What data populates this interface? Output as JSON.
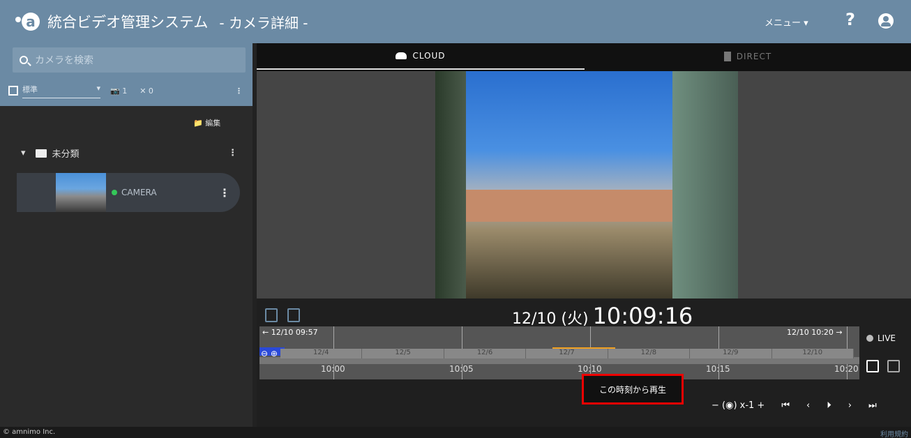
{
  "header": {
    "title": "統合ビデオ管理システム",
    "subtitle": "- カメラ詳細 -",
    "menu_label": "メニュー ▾",
    "help_label": "?"
  },
  "sidebar": {
    "search_placeholder": "カメラを検索",
    "filter_label": "標準",
    "online_count": "1",
    "offline_count": "0",
    "edit_label": "編集",
    "folder_name": "未分類",
    "camera_name": "CAMERA"
  },
  "tabs": [
    {
      "label": "CLOUD"
    },
    {
      "label": "DIRECT"
    }
  ],
  "player": {
    "date": "12/10 (火)",
    "time": "10:09:16",
    "range_start": "← 12/10 09:57",
    "range_end": "12/10 10:20 →",
    "time_labels": [
      "10:00",
      "10:05",
      "10:10",
      "10:15",
      "10:20"
    ],
    "day_labels": [
      "12/4",
      "12/5",
      "12/6",
      "12/7",
      "12/8",
      "12/9",
      "12/10"
    ],
    "live_label": "LIVE",
    "tooltip": "この時刻から再生",
    "speed_label": "− (◉) x-1 +",
    "prev_start": "⏮",
    "prev": "‹",
    "play": "⏵",
    "next": "›",
    "next_end": "⏭"
  },
  "footer": {
    "copyright": "© amnimo Inc.",
    "terms": "利用規約"
  }
}
